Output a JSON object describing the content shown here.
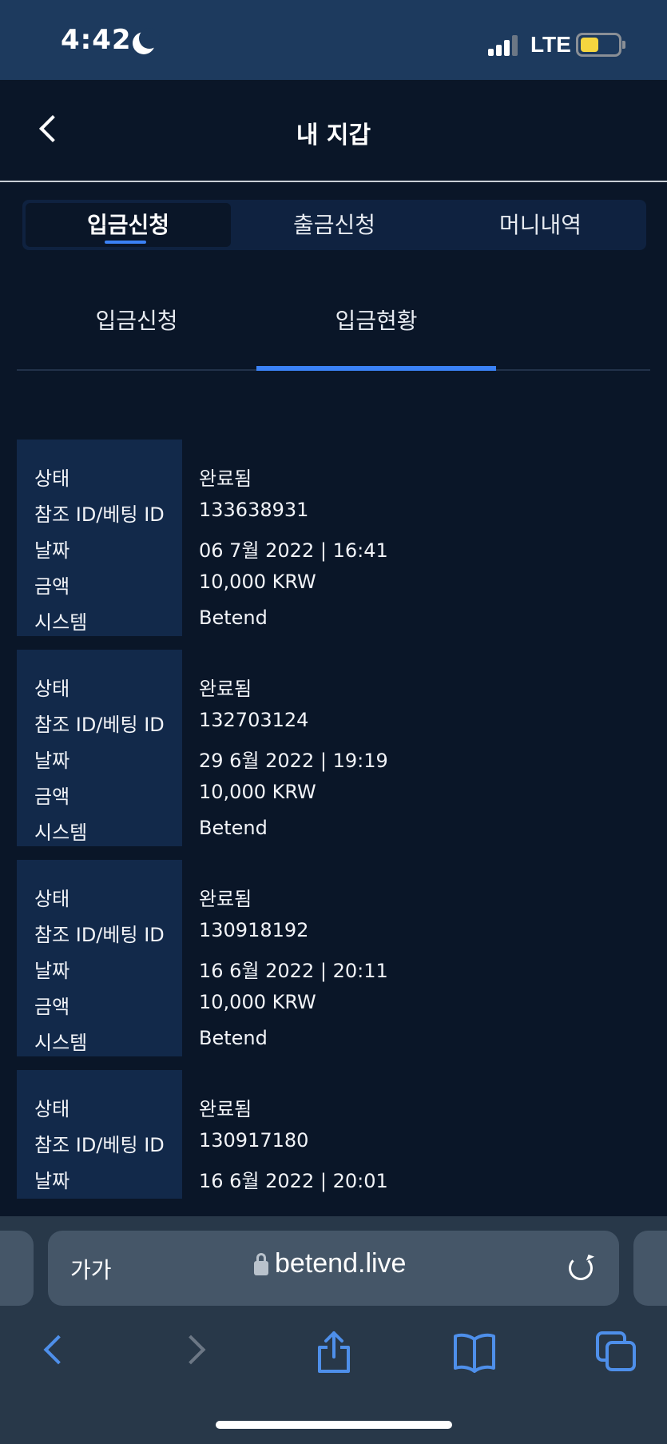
{
  "status_bar": {
    "time": "4:42",
    "network": "LTE",
    "moon": "moon-icon",
    "battery_color": "#f5d63f"
  },
  "header": {
    "title": "내 지갑",
    "back_icon": "chevron-left-icon"
  },
  "main_tabs": [
    {
      "label": "입금신청",
      "active": true
    },
    {
      "label": "출금신청",
      "active": false
    },
    {
      "label": "머니내역",
      "active": false
    }
  ],
  "sub_tabs": [
    {
      "label": "입금신청",
      "active": false
    },
    {
      "label": "입금현황",
      "active": true
    }
  ],
  "records": [
    {
      "rows": [
        {
          "label": "상태",
          "value": "완료됨"
        },
        {
          "label": "참조 ID/베팅 ID",
          "value": "133638931"
        },
        {
          "label": "날짜",
          "value": "06 7월 2022 | 16:41"
        },
        {
          "label": "금액",
          "value": "10,000 KRW"
        },
        {
          "label": "시스템",
          "value": "Betend"
        }
      ]
    },
    {
      "rows": [
        {
          "label": "상태",
          "value": "완료됨"
        },
        {
          "label": "참조 ID/베팅 ID",
          "value": "132703124"
        },
        {
          "label": "날짜",
          "value": "29 6월 2022 | 19:19"
        },
        {
          "label": "금액",
          "value": "10,000 KRW"
        },
        {
          "label": "시스템",
          "value": "Betend"
        }
      ]
    },
    {
      "rows": [
        {
          "label": "상태",
          "value": "완료됨"
        },
        {
          "label": "참조 ID/베팅 ID",
          "value": "130918192"
        },
        {
          "label": "날짜",
          "value": "16 6월 2022 | 20:11"
        },
        {
          "label": "금액",
          "value": "10,000 KRW"
        },
        {
          "label": "시스템",
          "value": "Betend"
        }
      ]
    },
    {
      "rows": [
        {
          "label": "상태",
          "value": "완료됨"
        },
        {
          "label": "참조 ID/베팅 ID",
          "value": "130917180"
        },
        {
          "label": "날짜",
          "value": "16 6월 2022 | 20:01"
        }
      ]
    }
  ],
  "browser": {
    "text_size_label": "가가",
    "url": "betend.live",
    "accent_color": "#4e8fea"
  }
}
